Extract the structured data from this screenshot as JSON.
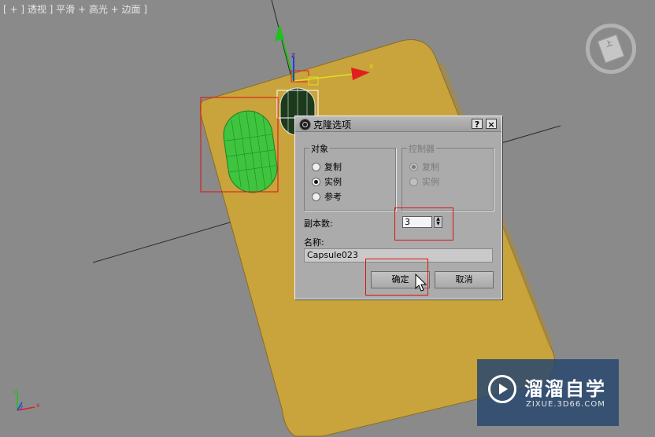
{
  "viewport": {
    "label": "[ + ] 透视 ] 平滑 + 高光 + 边面 ]"
  },
  "dialog": {
    "title": "克隆选项",
    "help_label": "?",
    "close_label": "×",
    "object_group": {
      "title": "对象",
      "options": [
        "复制",
        "实例",
        "参考"
      ],
      "selected": "实例"
    },
    "controller_group": {
      "title": "控制器",
      "options": [
        "复制",
        "实例"
      ],
      "selected": "复制",
      "disabled": true
    },
    "copies": {
      "label": "副本数:",
      "value": "3"
    },
    "name": {
      "label": "名称:",
      "value": "Capsule023"
    },
    "ok_label": "确定",
    "cancel_label": "取消"
  },
  "watermark": {
    "title": "溜溜自学",
    "subtitle": "ZIXUE.3D66.COM"
  },
  "gizmo": {
    "axis_z": "z",
    "axis_x": "x",
    "axis_y": "y"
  },
  "viewcube": {
    "face": "上"
  },
  "colors": {
    "plane": "#c9a33c",
    "capsule": "#3fc43f",
    "highlight_box": "#e01010",
    "gizmo_x": "#e02020",
    "gizmo_y": "#20c020",
    "gizmo_z": "#2040e0"
  }
}
